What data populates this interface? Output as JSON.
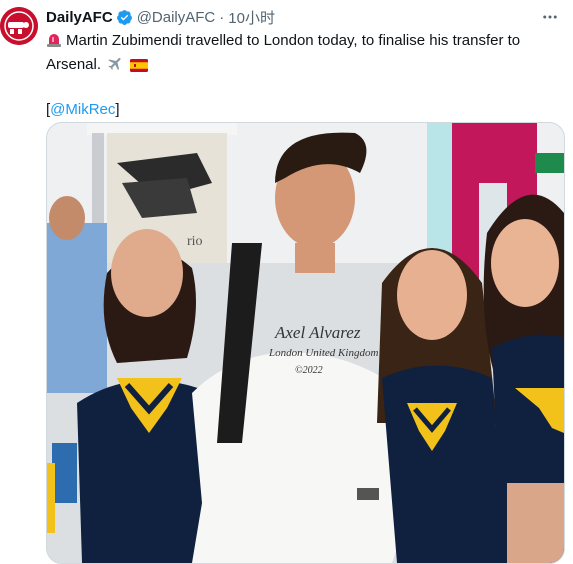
{
  "account": {
    "display_name": "DailyAFC",
    "handle": "@DailyAFC",
    "separator": "·",
    "time": "10小时",
    "avatar_text": "DAILY AFC"
  },
  "tweet": {
    "line1": "Martin Zubimendi travelled to London today, to finalise his transfer to",
    "line2": "Arsenal.",
    "mention_open": "[",
    "mention": "@MikRec",
    "mention_close": "]"
  },
  "photo": {
    "shirt_text_line1": "Axel Alvarez",
    "shirt_text_line2": "London United Kingdom",
    "shirt_text_line3": "©2022",
    "poster_text": "rio"
  },
  "icons": {
    "alarm": "rotating-light-icon",
    "plane": "airplane-icon",
    "flag": "spain-flag-icon",
    "verified": "verified-badge-icon",
    "more": "more-horizontal-icon"
  },
  "colors": {
    "link": "#1d9bf0",
    "verified": "#1d9bf0",
    "secondary_text": "#536471",
    "avatar_bg": "#c8102e"
  }
}
